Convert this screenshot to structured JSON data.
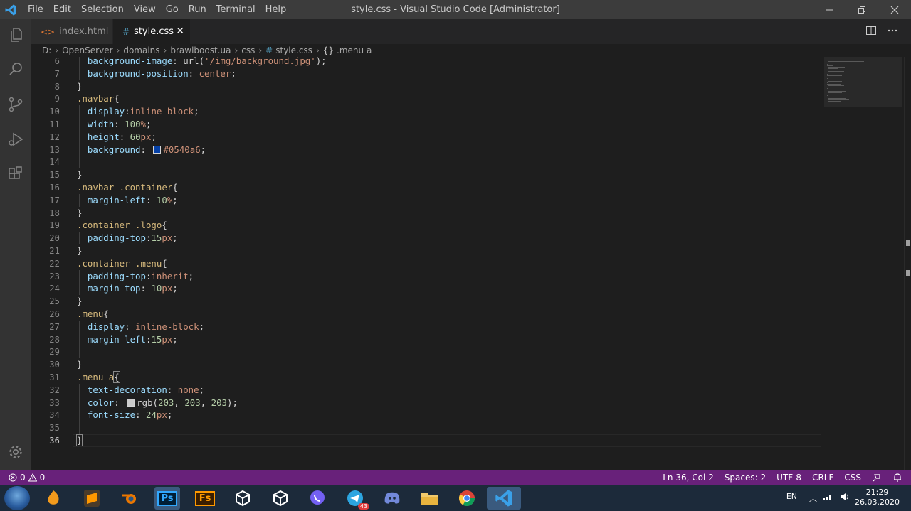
{
  "titlebar": {
    "menu": [
      "File",
      "Edit",
      "Selection",
      "View",
      "Go",
      "Run",
      "Terminal",
      "Help"
    ],
    "title": "style.css - Visual Studio Code [Administrator]"
  },
  "activity_bar": [
    "files-icon",
    "search-icon",
    "source-control-icon",
    "run-debug-icon",
    "extensions-icon",
    "settings-gear-icon"
  ],
  "tabs": [
    {
      "label": "index.html",
      "icon": "<>"
    },
    {
      "label": "style.css",
      "icon": "#",
      "active": true
    }
  ],
  "breadcrumb": [
    "D:",
    "OpenServer",
    "domains",
    "brawlboost.ua",
    "css",
    "style.css",
    ".menu a"
  ],
  "editor": {
    "active_line": "36",
    "lines": [
      {
        "n": "6",
        "text": "  background-image: url('/img/background.jpg');"
      },
      {
        "n": "7",
        "text": "  background-position: center;"
      },
      {
        "n": "8",
        "text": "}"
      },
      {
        "n": "9",
        "text": ".navbar{"
      },
      {
        "n": "10",
        "text": "  display:inline-block;"
      },
      {
        "n": "11",
        "text": "  width: 100%;"
      },
      {
        "n": "12",
        "text": "  height: 60px;"
      },
      {
        "n": "13",
        "text": "  background: #0540a6;"
      },
      {
        "n": "14",
        "text": ""
      },
      {
        "n": "15",
        "text": "}"
      },
      {
        "n": "16",
        "text": ".navbar .container{"
      },
      {
        "n": "17",
        "text": "  margin-left: 10%;"
      },
      {
        "n": "18",
        "text": "}"
      },
      {
        "n": "19",
        "text": ".container .logo{"
      },
      {
        "n": "20",
        "text": "  padding-top:15px;"
      },
      {
        "n": "21",
        "text": "}"
      },
      {
        "n": "22",
        "text": ".container .menu{"
      },
      {
        "n": "23",
        "text": "  padding-top:inherit;"
      },
      {
        "n": "24",
        "text": "  margin-top:-10px;"
      },
      {
        "n": "25",
        "text": "}"
      },
      {
        "n": "26",
        "text": ".menu{"
      },
      {
        "n": "27",
        "text": "  display: inline-block;"
      },
      {
        "n": "28",
        "text": "  margin-left:15px;"
      },
      {
        "n": "29",
        "text": ""
      },
      {
        "n": "30",
        "text": "}"
      },
      {
        "n": "31",
        "text": ".menu a{"
      },
      {
        "n": "32",
        "text": "  text-decoration: none;"
      },
      {
        "n": "33",
        "text": "  color: rgb(203, 203, 203);"
      },
      {
        "n": "34",
        "text": "  font-size: 24px;"
      },
      {
        "n": "35",
        "text": ""
      },
      {
        "n": "36",
        "text": "}"
      }
    ],
    "swatch_colors": {
      "navbar_bg": "#0540a6",
      "menu_link": "#cbcbcb"
    }
  },
  "statusbar": {
    "errors": "0",
    "warnings": "0",
    "position": "Ln 36, Col 2",
    "spaces": "Spaces: 2",
    "encoding": "UTF-8",
    "eol": "CRLF",
    "language": "CSS",
    "color": "#68217a"
  },
  "taskbar": {
    "apps": [
      "start-button",
      "fl-studio",
      "sublime-text",
      "blender",
      "photoshop",
      "fuse",
      "unity",
      "unity",
      "viber",
      "telegram",
      "discord",
      "file-explorer",
      "chrome",
      "vscode"
    ],
    "telegram_badge": "43",
    "lang": "EN",
    "time": "21:29",
    "date": "26.03.2020"
  }
}
